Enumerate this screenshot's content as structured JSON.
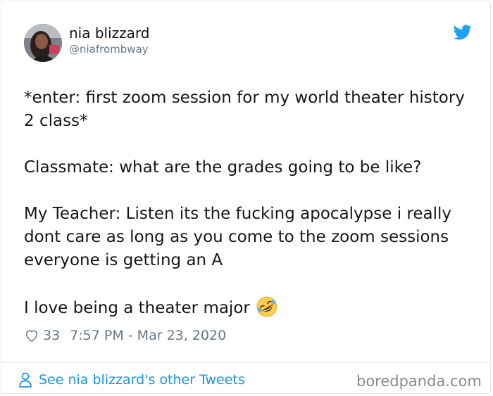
{
  "author": {
    "display_name": "nia blizzard",
    "handle": "@niafrombway"
  },
  "tweet": {
    "paragraphs": [
      "*enter: first zoom session for my world theater history 2 class*",
      "Classmate: what are the grades going to be like?",
      "My Teacher: Listen its the fucking apocalypse i really dont care as long as you come to the zoom sessions everyone is getting an A",
      "I love being a theater major"
    ],
    "emoji": "rolling-on-the-floor-laughing-icon"
  },
  "meta": {
    "like_count": "33",
    "timestamp": "7:57 PM - Mar 23, 2020"
  },
  "footer": {
    "other_tweets_label": "See nia blizzard's other Tweets"
  },
  "watermark": "boredpanda.com",
  "colors": {
    "twitter_blue": "#1da1f2",
    "link_blue": "#1b95e0",
    "secondary_text": "#657786",
    "primary_text": "#14171a"
  }
}
